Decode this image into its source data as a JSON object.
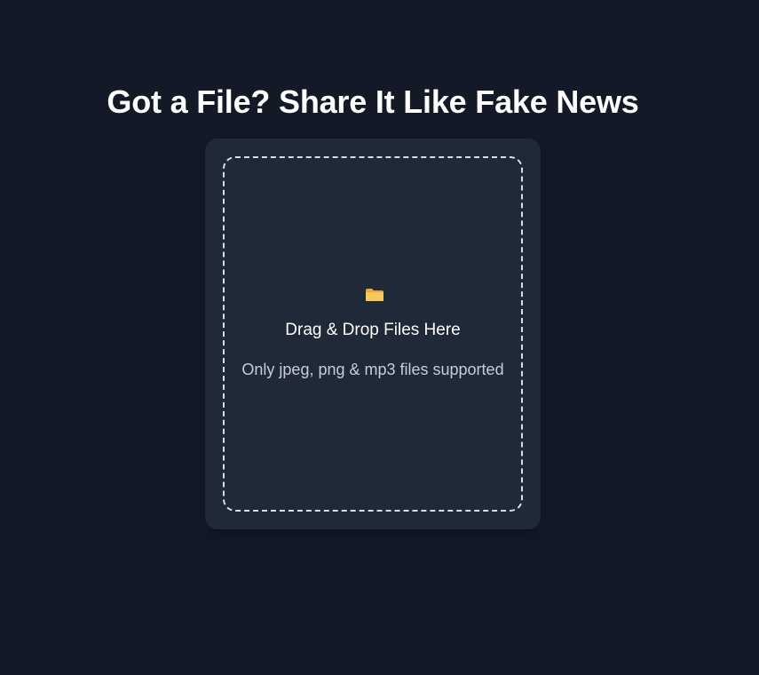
{
  "page": {
    "title": "Got a File? Share It Like Fake News"
  },
  "dropzone": {
    "icon": "folder-icon",
    "title": "Drag & Drop Files Here",
    "subtitle": "Only jpeg, png & mp3 files supported"
  },
  "colors": {
    "background": "#131927",
    "card": "#202938",
    "dashed_border": "#d8dde6",
    "folder": "#f2c14e"
  }
}
